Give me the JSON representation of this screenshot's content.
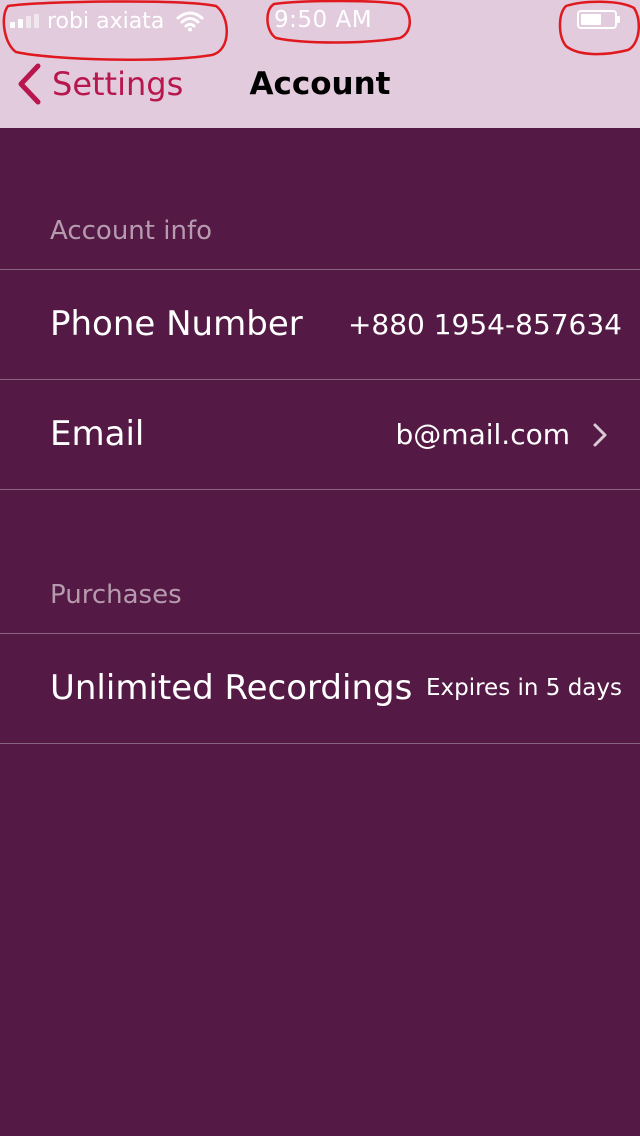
{
  "status_bar": {
    "carrier": "robi axiata",
    "time": "9:50 AM",
    "icons": [
      "signal-icon",
      "wifi-icon",
      "battery-icon"
    ]
  },
  "nav": {
    "back_label": "Settings",
    "title": "Account"
  },
  "sections": [
    {
      "header": "Account info",
      "rows": [
        {
          "label": "Phone Number",
          "value": "+880 1954-857634"
        },
        {
          "label": "Email",
          "value": "b@mail.com"
        }
      ]
    },
    {
      "header": "Purchases",
      "rows": [
        {
          "label": "Unlimited Recordings",
          "value": "Expires in 5 days"
        }
      ]
    }
  ],
  "colors": {
    "background": "#541944",
    "header_background": "#e2cbdc",
    "accent": "#b8174e",
    "section_header": "#b69bae",
    "separator": "#8a6282",
    "annotation": "#e0191f"
  }
}
